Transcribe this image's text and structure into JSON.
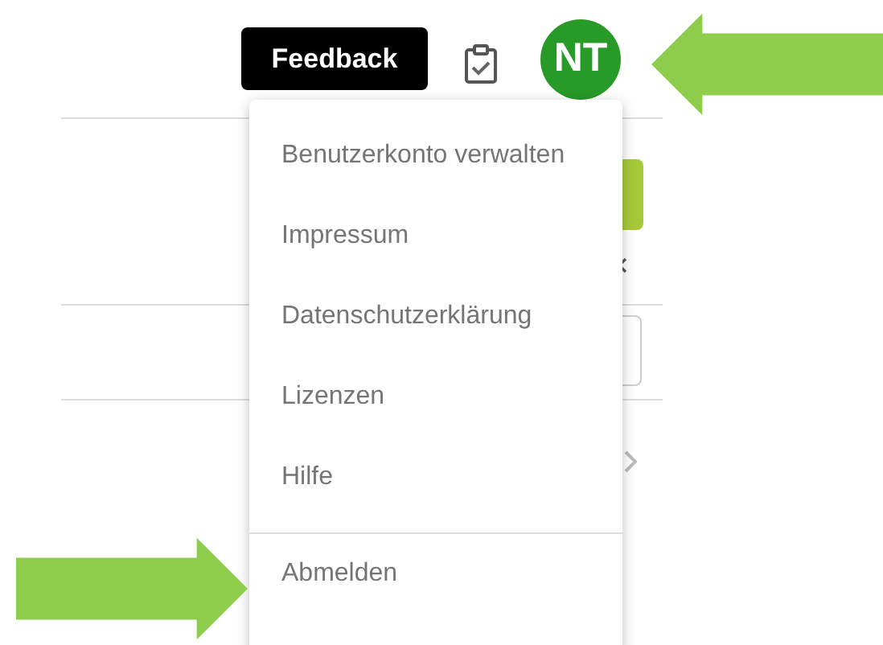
{
  "header": {
    "feedback_button": "Feedback",
    "avatar": {
      "initials": "NT"
    }
  },
  "user_menu": {
    "items": [
      "Benutzerkonto verwalten",
      "Impressum",
      "Datenschutzerklärung",
      "Lizenzen",
      "Hilfe"
    ],
    "footer_items": [
      "Abmelden"
    ]
  }
}
